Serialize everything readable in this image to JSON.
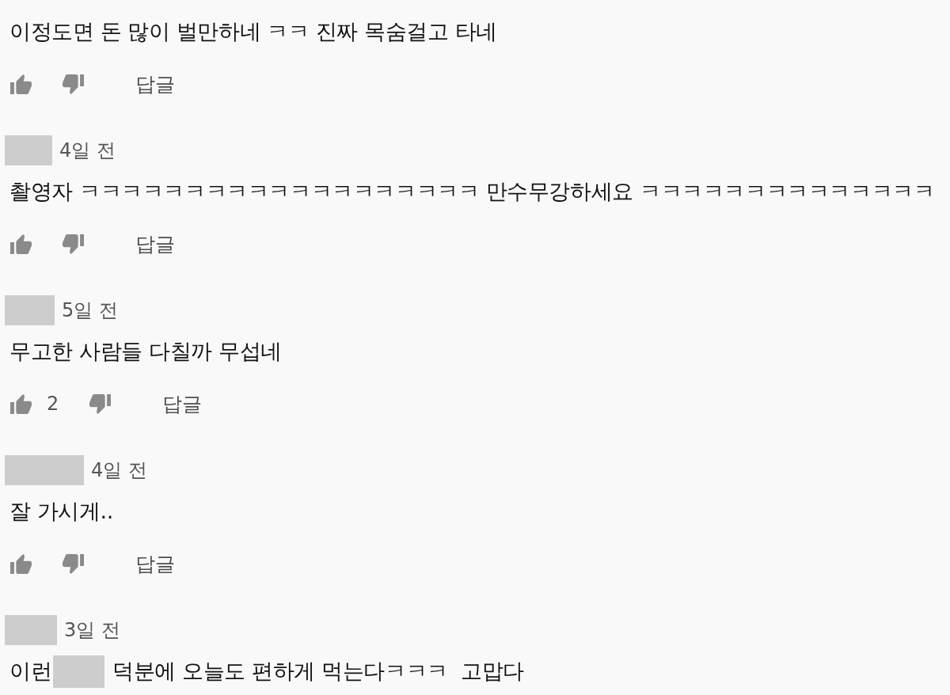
{
  "comments": [
    {
      "body": [
        {
          "kind": "text",
          "text": "이정도면 돈 많이 벌만하네 ㅋㅋ 진짜 목숨걸고 타네"
        }
      ],
      "reply": "답글"
    },
    {
      "time": "4일 전",
      "body": [
        {
          "kind": "text",
          "text": "촬영자 ㅋㅋㅋㅋㅋㅋㅋㅋㅋㅋㅋㅋㅋㅋㅋㅋㅋㅋㅋ 만수무강하세요 ㅋㅋㅋㅋㅋㅋㅋㅋㅋㅋㅋㅋㅋㅋ"
        }
      ],
      "reply": "답글"
    },
    {
      "time": "5일 전",
      "body": [
        {
          "kind": "text",
          "text": "무고한 사람들 다칠까 무섭네"
        }
      ],
      "likes": "2",
      "reply": "답글"
    },
    {
      "time": "4일 전",
      "body": [
        {
          "kind": "text",
          "text": "잘 가시게.."
        }
      ],
      "reply": "답글"
    },
    {
      "time": "3일 전",
      "body": [
        {
          "kind": "text",
          "text": "이런"
        },
        {
          "kind": "redacted"
        },
        {
          "kind": "text",
          "text": "덕분에 오늘도 편하게 먹는다ㅋㅋㅋ  고맙다"
        }
      ]
    }
  ]
}
